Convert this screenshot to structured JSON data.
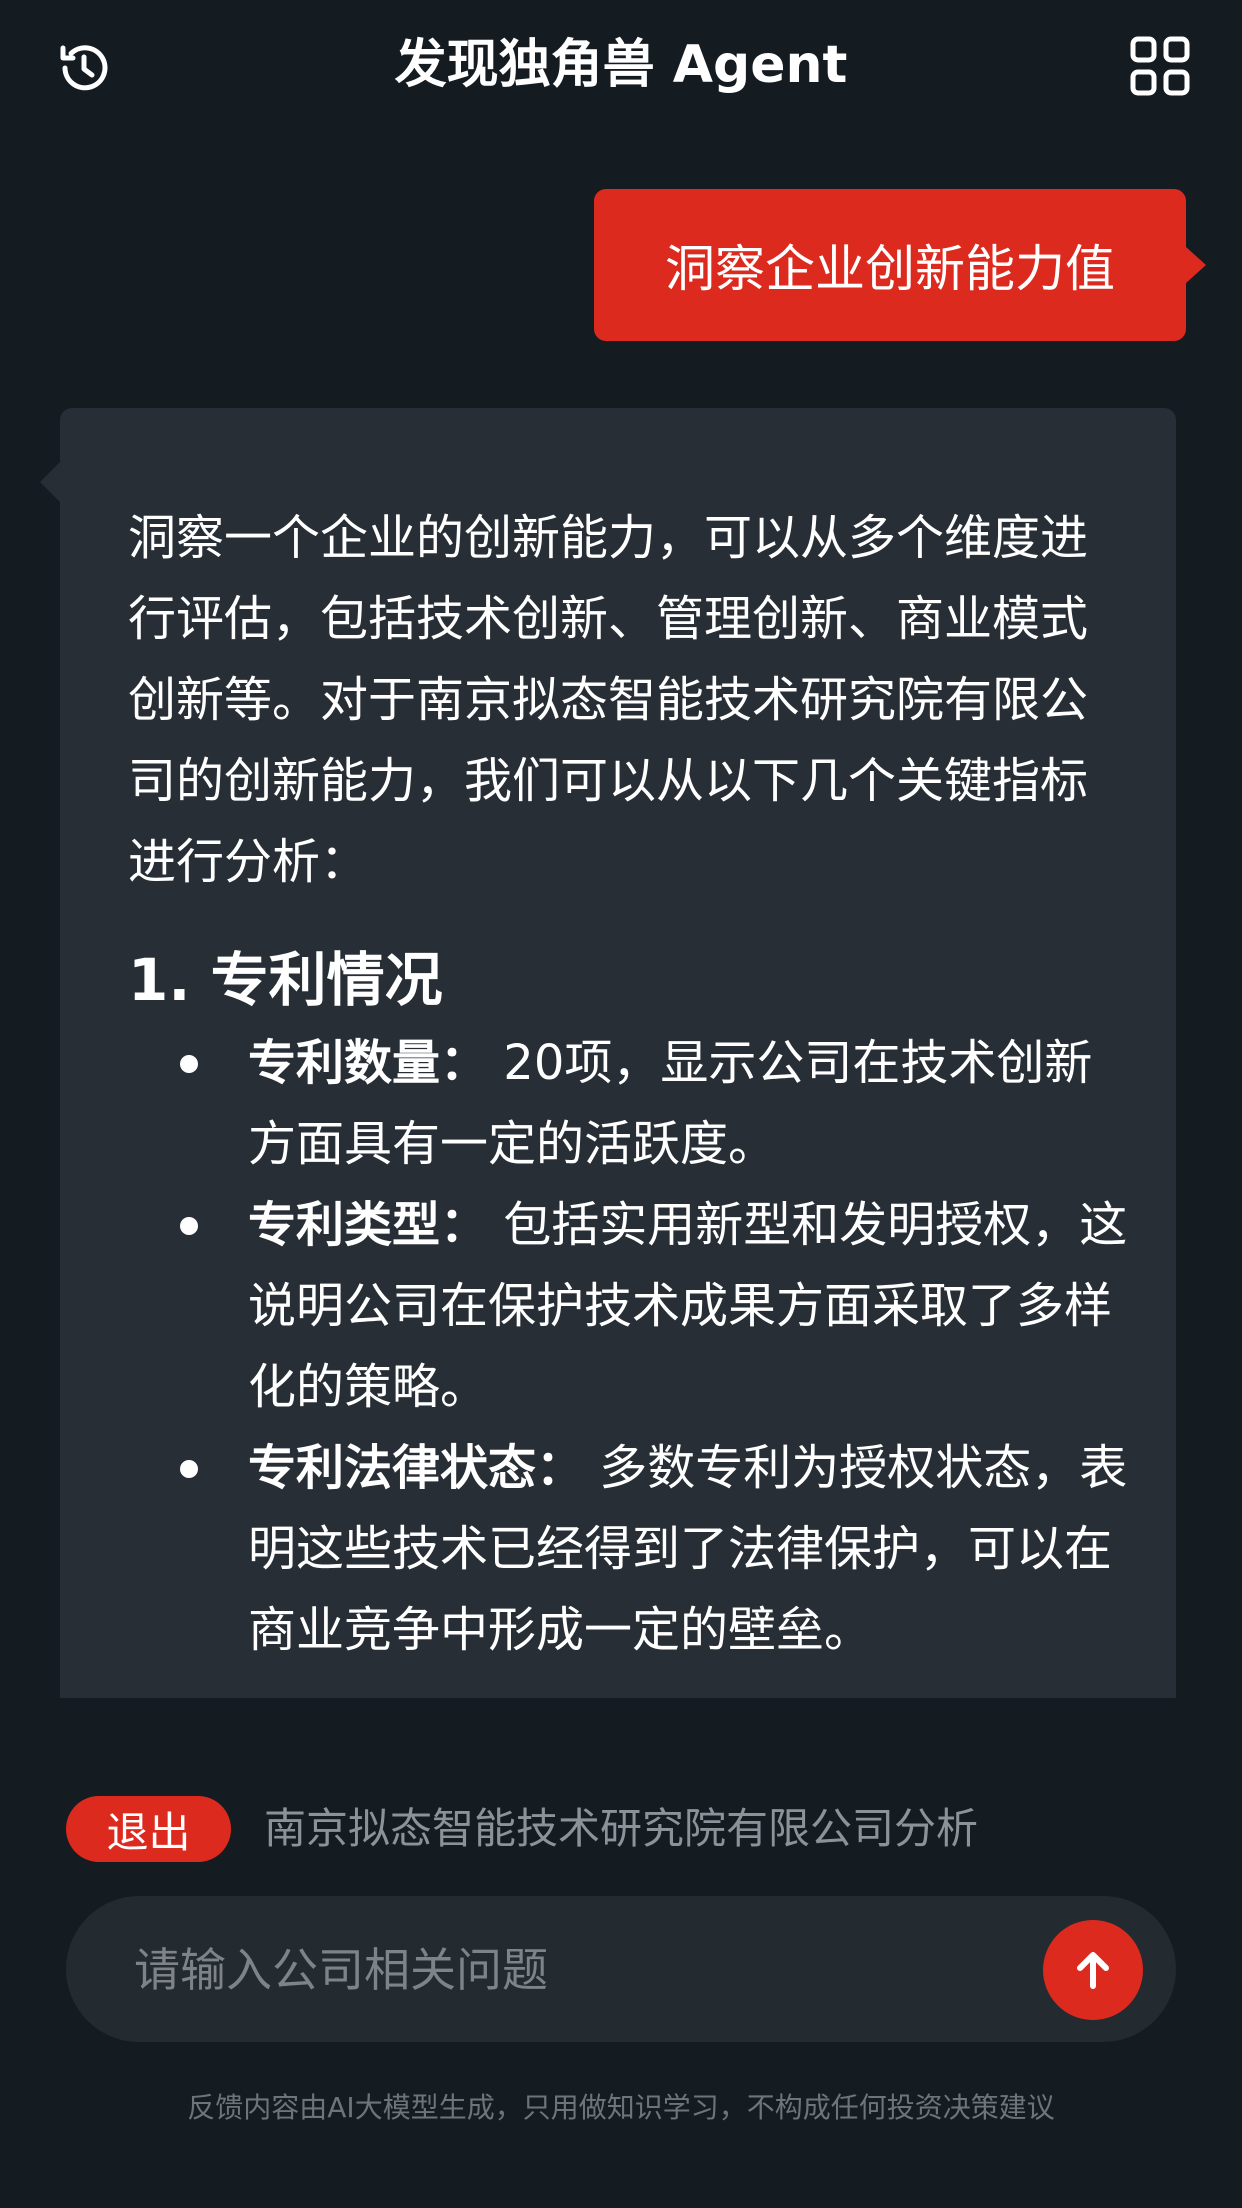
{
  "header": {
    "title": "发现独角兽 Agent",
    "left_icon": "history-icon",
    "right_icon": "apps-grid-icon"
  },
  "chat": {
    "user_message": "洞察企业创新能力值",
    "ai_intro": "洞察一个企业的创新能力，可以从多个维度进行评估，包括技术创新、管理创新、商业模式创新等。对于南京拟态智能技术研究院有限公司的创新能力，我们可以从以下几个关键指标进行分析：",
    "section_title": "1. 专利情况",
    "bullets": [
      {
        "label": "专利数量：",
        "text": "20项，显示公司在技术创新方面具有一定的活跃度。"
      },
      {
        "label": "专利类型：",
        "text": "包括实用新型和发明授权，这说明公司在保护技术成果方面采取了多样化的策略。"
      },
      {
        "label": "专利法律状态：",
        "text": "多数专利为授权状态，表明这些技术已经得到了法律保护，可以在商业竞争中形成一定的壁垒。"
      }
    ]
  },
  "context_bar": {
    "exit_label": "退出",
    "company_label": "南京拟态智能技术研究院有限公司分析"
  },
  "input": {
    "placeholder": "请输入公司相关问题",
    "send_icon": "arrow-up-icon"
  },
  "footer": {
    "disclaimer": "反馈内容由AI大模型生成，只用做知识学习，不构成任何投资决策建议"
  },
  "colors": {
    "background": "#141b21",
    "accent": "#dd2a1f",
    "bubble": "#272e35",
    "input_bg": "#232a30"
  }
}
